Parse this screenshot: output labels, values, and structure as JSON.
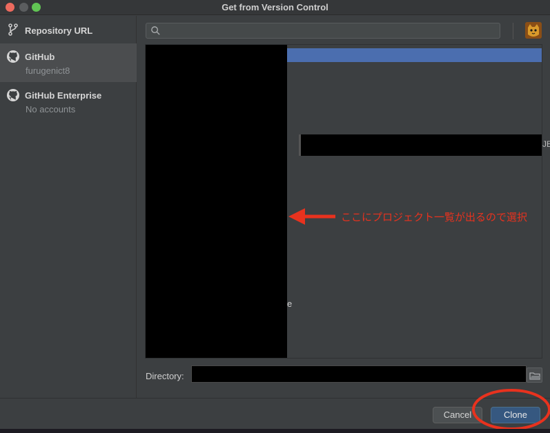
{
  "window": {
    "title": "Get from Version Control"
  },
  "sidebar": {
    "items": [
      {
        "label": "Repository URL",
        "sub": "",
        "icon": "branch-icon"
      },
      {
        "label": "GitHub",
        "sub": "furugenict8",
        "icon": "github-icon",
        "selected": true
      },
      {
        "label": "GitHub Enterprise",
        "sub": "No accounts",
        "icon": "github-icon"
      }
    ]
  },
  "search": {
    "value": "",
    "placeholder": ""
  },
  "repo_list": {
    "edge_text": "JE",
    "stray_text": "e"
  },
  "annotation": {
    "text": "ここにプロジェクト一覧が出るので選択",
    "color": "#e8321e"
  },
  "directory": {
    "label": "Directory:",
    "value": ""
  },
  "buttons": {
    "cancel": "Cancel",
    "clone": "Clone"
  },
  "colors": {
    "selection": "#4b6eaf",
    "clone_button": "#365880"
  }
}
